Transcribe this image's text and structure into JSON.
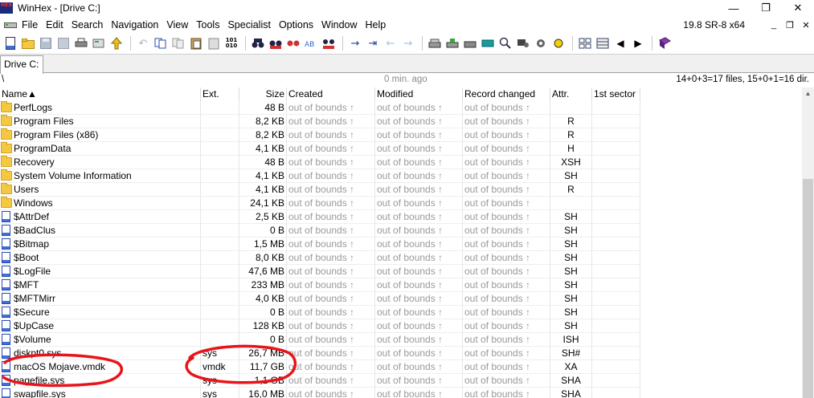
{
  "window": {
    "title": "WinHex - [Drive C:]",
    "logo_text": "HEX",
    "minimize": "—",
    "maximize": "❐",
    "close": "✕"
  },
  "menu": {
    "items": [
      "File",
      "Edit",
      "Search",
      "Navigation",
      "View",
      "Tools",
      "Specialist",
      "Options",
      "Window",
      "Help"
    ],
    "version": "19.8 SR-8 x64",
    "mdi_minimize": "_",
    "mdi_restore": "❐",
    "mdi_close": "✕"
  },
  "tabs": [
    {
      "label": "Drive C:"
    }
  ],
  "pathbar": {
    "path": "\\",
    "snapshot": "0 min. ago",
    "counts": "14+0+3=17 files, 15+0+1=16 dir."
  },
  "table": {
    "columns": {
      "name": "Name▲",
      "ext": "Ext.",
      "size": "Size",
      "created": "Created",
      "modified": "Modified",
      "record": "Record changed",
      "attr": "Attr.",
      "sector": "1st sector"
    },
    "rows": [
      {
        "type": "folder",
        "name": "PerfLogs",
        "ext": "",
        "size": "48 B",
        "created": "out of bounds ↑",
        "modified": "out of bounds ↑",
        "record": "out of bounds ↑",
        "attr": ""
      },
      {
        "type": "folder",
        "name": "Program Files",
        "ext": "",
        "size": "8,2 KB",
        "created": "out of bounds ↑",
        "modified": "out of bounds ↑",
        "record": "out of bounds ↑",
        "attr": "R"
      },
      {
        "type": "folder",
        "name": "Program Files (x86)",
        "ext": "",
        "size": "8,2 KB",
        "created": "out of bounds ↑",
        "modified": "out of bounds ↑",
        "record": "out of bounds ↑",
        "attr": "R"
      },
      {
        "type": "folder",
        "name": "ProgramData",
        "ext": "",
        "size": "4,1 KB",
        "created": "out of bounds ↑",
        "modified": "out of bounds ↑",
        "record": "out of bounds ↑",
        "attr": "H"
      },
      {
        "type": "folder",
        "name": "Recovery",
        "ext": "",
        "size": "48 B",
        "created": "out of bounds ↑",
        "modified": "out of bounds ↑",
        "record": "out of bounds ↑",
        "attr": "XSH"
      },
      {
        "type": "folder",
        "name": "System Volume Information",
        "ext": "",
        "size": "4,1 KB",
        "created": "out of bounds ↑",
        "modified": "out of bounds ↑",
        "record": "out of bounds ↑",
        "attr": "SH"
      },
      {
        "type": "folder",
        "name": "Users",
        "ext": "",
        "size": "4,1 KB",
        "created": "out of bounds ↑",
        "modified": "out of bounds ↑",
        "record": "out of bounds ↑",
        "attr": "R"
      },
      {
        "type": "folder",
        "name": "Windows",
        "ext": "",
        "size": "24,1 KB",
        "created": "out of bounds ↑",
        "modified": "out of bounds ↑",
        "record": "out of bounds ↑",
        "attr": ""
      },
      {
        "type": "file",
        "name": "$AttrDef",
        "ext": "",
        "size": "2,5 KB",
        "created": "out of bounds ↑",
        "modified": "out of bounds ↑",
        "record": "out of bounds ↑",
        "attr": "SH"
      },
      {
        "type": "file",
        "name": "$BadClus",
        "ext": "",
        "size": "0 B",
        "created": "out of bounds ↑",
        "modified": "out of bounds ↑",
        "record": "out of bounds ↑",
        "attr": "SH"
      },
      {
        "type": "file",
        "name": "$Bitmap",
        "ext": "",
        "size": "1,5 MB",
        "created": "out of bounds ↑",
        "modified": "out of bounds ↑",
        "record": "out of bounds ↑",
        "attr": "SH"
      },
      {
        "type": "file",
        "name": "$Boot",
        "ext": "",
        "size": "8,0 KB",
        "created": "out of bounds ↑",
        "modified": "out of bounds ↑",
        "record": "out of bounds ↑",
        "attr": "SH"
      },
      {
        "type": "file",
        "name": "$LogFile",
        "ext": "",
        "size": "47,6 MB",
        "created": "out of bounds ↑",
        "modified": "out of bounds ↑",
        "record": "out of bounds ↑",
        "attr": "SH"
      },
      {
        "type": "file",
        "name": "$MFT",
        "ext": "",
        "size": "233 MB",
        "created": "out of bounds ↑",
        "modified": "out of bounds ↑",
        "record": "out of bounds ↑",
        "attr": "SH"
      },
      {
        "type": "file",
        "name": "$MFTMirr",
        "ext": "",
        "size": "4,0 KB",
        "created": "out of bounds ↑",
        "modified": "out of bounds ↑",
        "record": "out of bounds ↑",
        "attr": "SH"
      },
      {
        "type": "file",
        "name": "$Secure",
        "ext": "",
        "size": "0 B",
        "created": "out of bounds ↑",
        "modified": "out of bounds ↑",
        "record": "out of bounds ↑",
        "attr": "SH"
      },
      {
        "type": "file",
        "name": "$UpCase",
        "ext": "",
        "size": "128 KB",
        "created": "out of bounds ↑",
        "modified": "out of bounds ↑",
        "record": "out of bounds ↑",
        "attr": "SH"
      },
      {
        "type": "file",
        "name": "$Volume",
        "ext": "",
        "size": "0 B",
        "created": "out of bounds ↑",
        "modified": "out of bounds ↑",
        "record": "out of bounds ↑",
        "attr": "ISH"
      },
      {
        "type": "file",
        "name": "diskpt0.sys",
        "ext": "sys",
        "size": "26,7 MB",
        "created": "out of bounds ↑",
        "modified": "out of bounds ↑",
        "record": "out of bounds ↑",
        "attr": "SH#"
      },
      {
        "type": "file",
        "name": "macOS Mojave.vmdk",
        "ext": "vmdk",
        "size": "11,7 GB",
        "created": "out of bounds ↑",
        "modified": "out of bounds ↑",
        "record": "out of bounds ↑",
        "attr": "XA"
      },
      {
        "type": "file",
        "name": "pagefile.sys",
        "ext": "sys",
        "size": "1,1 GB",
        "created": "out of bounds ↑",
        "modified": "out of bounds ↑",
        "record": "out of bounds ↑",
        "attr": "SHA"
      },
      {
        "type": "file",
        "name": "swapfile.sys",
        "ext": "sys",
        "size": "16,0 MB",
        "created": "out of bounds ↑",
        "modified": "out of bounds ↑",
        "record": "out of bounds ↑",
        "attr": "SHA"
      }
    ]
  },
  "annotation_color": "#e8141b"
}
